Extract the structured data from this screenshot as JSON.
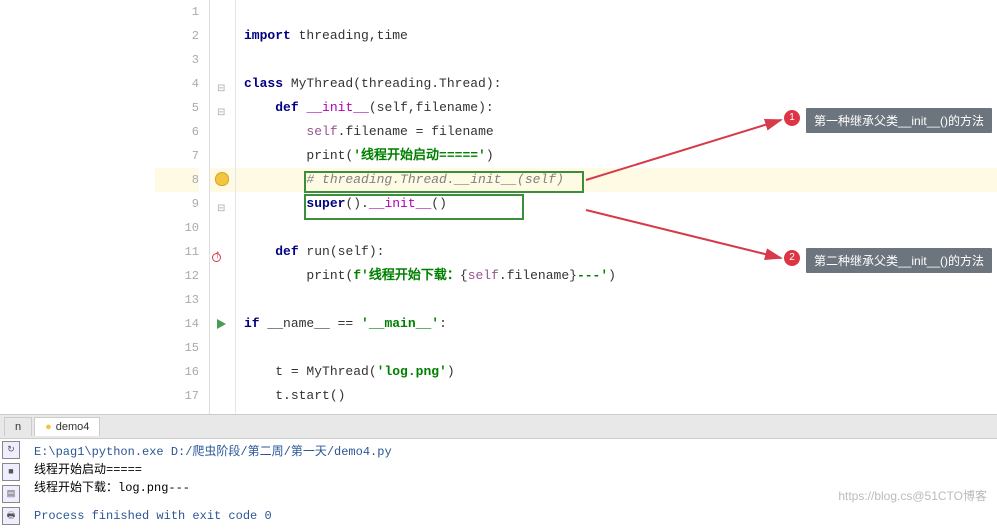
{
  "editor": {
    "line_numbers": [
      "1",
      "2",
      "3",
      "4",
      "5",
      "6",
      "7",
      "8",
      "9",
      "10",
      "11",
      "12",
      "13",
      "14",
      "15",
      "16",
      "17"
    ],
    "lines": {
      "l1": "",
      "l2_kw": "import",
      "l2_rest": " threading,time",
      "l4_kw": "class",
      "l4_name": " MyThread(threading.Thread):",
      "l5_kw": "def",
      "l5_dunder": "__init__",
      "l5_sig": "(self,filename):",
      "l6_self": "self",
      "l6_rest": ".filename = filename",
      "l7_print": "print",
      "l7_str": "'线程开始启动====='",
      "l8_comment": "# threading.Thread.__init__(self)",
      "l9_super": "super",
      "l9_dunder": "__init__",
      "l11_kw": "def",
      "l11_name": " run",
      "l11_sig": "(self):",
      "l12_print": "print",
      "l12_p1": "f'",
      "l12_txt": "线程开始下载：",
      "l12_expr_o": "{",
      "l12_expr_self": "self",
      "l12_expr_attr": ".filename",
      "l12_expr_c": "}",
      "l12_tail": "---'",
      "l14_kw": "if",
      "l14_name": " __name__ ",
      "l14_eq": "==",
      "l14_str": " '__main__'",
      "l14_colon": ":",
      "l16_t": "t = MyThread(",
      "l16_arg": "'log.png'",
      "l16_close": ")",
      "l17": "t.start()"
    }
  },
  "callouts": {
    "c1_badge": "1",
    "c1_text": "第一种继承父类__init__()的方法",
    "c2_badge": "2",
    "c2_text": "第二种继承父类__init__()的方法"
  },
  "tabs": {
    "t1": "n",
    "t2": "demo4"
  },
  "console": {
    "path": "E:\\pag1\\python.exe D:/爬虫阶段/第二周/第一天/demo4.py",
    "out1": "线程开始启动=====",
    "out2": "线程开始下载：log.png---",
    "exit": "Process finished with exit code 0"
  },
  "watermark": "https://blog.cs@51CTO博客"
}
